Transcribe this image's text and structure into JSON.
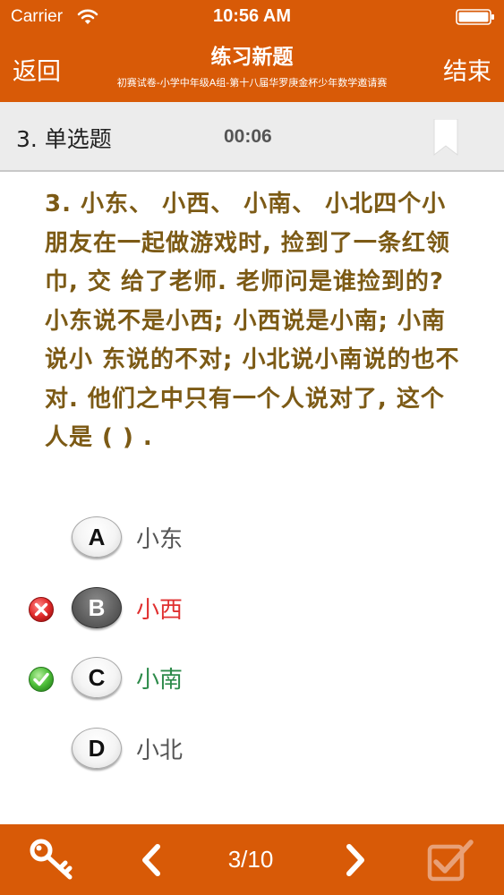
{
  "status_bar": {
    "carrier": "Carrier",
    "time": "10:56 AM"
  },
  "nav": {
    "back_label": "返回",
    "title": "练习新题",
    "subtitle": "初赛试卷-小学中年级A组-第十八届华罗庚金杯少年数学邀请赛",
    "end_label": "结束"
  },
  "question_meta": {
    "type_label": "3. 单选题",
    "timer": "00:06"
  },
  "question": {
    "text": "3. 小东、 小西、 小南、 小北四个小朋友在一起做游戏时, 捡到了一条红领巾, 交 给了老师. 老师问是谁捡到的? 小东说不是小西; 小西说是小南; 小南说小 东说的不对; 小北说小南说的也不对. 他们之中只有一个人说对了, 这个人是 ( ) ."
  },
  "options": [
    {
      "letter": "A",
      "text": "小东",
      "state": "normal"
    },
    {
      "letter": "B",
      "text": "小西",
      "state": "wrong"
    },
    {
      "letter": "C",
      "text": "小南",
      "state": "correct"
    },
    {
      "letter": "D",
      "text": "小北",
      "state": "normal"
    }
  ],
  "toolbar": {
    "page_indicator": "3/10"
  },
  "colors": {
    "accent": "#d85a07",
    "question_text": "#7c5a15",
    "wrong": "#e03030",
    "correct": "#2e8b4b"
  },
  "icons": {
    "wifi": "wifi-icon",
    "battery": "battery-icon",
    "bookmark": "bookmark-icon",
    "wrong_mark": "cross-icon",
    "correct_mark": "check-icon",
    "answer_key": "key-icon",
    "prev": "chevron-left-icon",
    "next": "chevron-right-icon",
    "submit": "checkbox-icon"
  }
}
